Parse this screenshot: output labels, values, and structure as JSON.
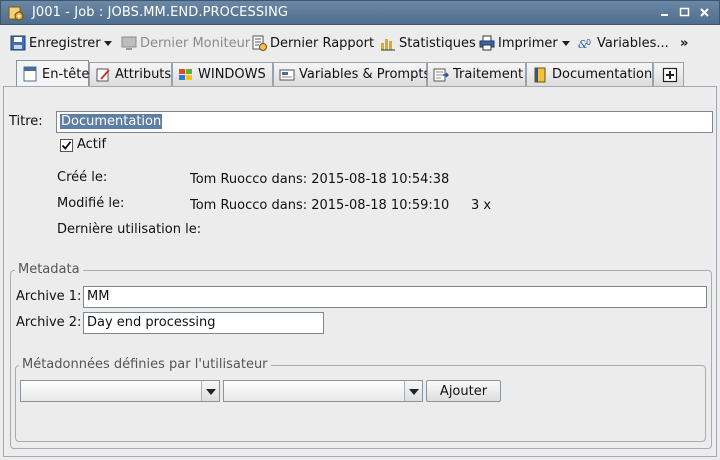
{
  "window": {
    "title": "J001 - Job : JOBS.MM.END.PROCESSING",
    "icons": {
      "app": "job-gear-icon",
      "minimize": "minimize-icon",
      "maximize": "maximize-icon",
      "close": "close-icon"
    }
  },
  "toolbar": {
    "save_label": "Enregistrer",
    "monitor_label": "Dernier Moniteur",
    "report_label": "Dernier Rapport",
    "stats_label": "Statistiques",
    "print_label": "Imprimer",
    "variables_label": "Variables...",
    "overflow_label": "»"
  },
  "tabs": [
    {
      "label": "En-tête",
      "icon": "header-icon",
      "active": true
    },
    {
      "label": "Attributs",
      "icon": "attributes-icon",
      "active": false
    },
    {
      "label": "WINDOWS",
      "icon": "windows-icon",
      "active": false
    },
    {
      "label": "Variables & Prompts",
      "icon": "variables-icon",
      "active": false
    },
    {
      "label": "Traitement",
      "icon": "processing-icon",
      "active": false
    },
    {
      "label": "Documentation",
      "icon": "documentation-icon",
      "active": false
    },
    {
      "label": "+",
      "icon": "add-tab-icon",
      "active": false
    }
  ],
  "header": {
    "title_label": "Titre:",
    "title_value": "Documentation",
    "active_label": "Actif",
    "active_checked": true,
    "created_label": "Créé le:",
    "created_value": "Tom Ruocco dans: 2015-08-18 10:54:38",
    "modified_label": "Modifié le:",
    "modified_value": "Tom Ruocco dans: 2015-08-18 10:59:10",
    "modified_count": "3 x",
    "last_used_label": "Dernière utilisation le:"
  },
  "metadata": {
    "group_title": "Metadata",
    "archive1_label": "Archive 1:",
    "archive1_value": "MM",
    "archive2_label": "Archive 2:",
    "archive2_value": "Day end processing",
    "user_group_title": "Métadonnées définies par l'utilisateur",
    "add_button_label": "Ajouter"
  },
  "colors": {
    "titlebar": "#4f6d8c",
    "selection": "#5c7fa3",
    "background": "#ececec"
  }
}
